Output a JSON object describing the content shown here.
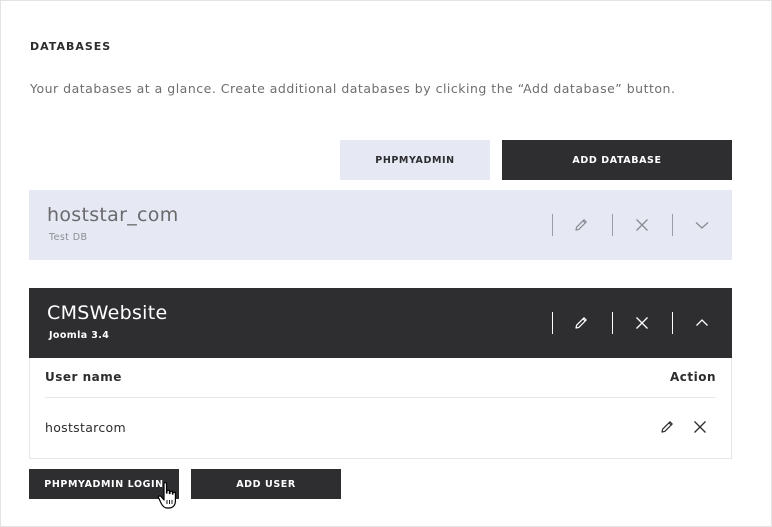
{
  "section": {
    "title": "DATABASES",
    "description": "Your databases at a glance. Create additional databases by clicking the “Add database” button."
  },
  "toolbar": {
    "phpmyadmin_label": "PHPMYADMIN",
    "add_database_label": "ADD DATABASE"
  },
  "databases": [
    {
      "name": "hoststar_com",
      "description": "Test DB",
      "expanded": false
    },
    {
      "name": "CMSWebsite",
      "description": "Joomla 3.4",
      "expanded": true
    }
  ],
  "users_table": {
    "columns": [
      "User name",
      "Action"
    ],
    "rows": [
      {
        "username": "hoststarcom"
      }
    ]
  },
  "footer_actions": {
    "phpmyadmin_login_label": "PHPMYADMIN LOGIN",
    "add_user_label": "ADD USER"
  },
  "icons": {
    "edit": "pencil-icon",
    "delete": "close-icon",
    "expand": "chevron-down-icon",
    "collapse": "chevron-up-icon",
    "cursor": "hand-pointer-icon"
  },
  "colors": {
    "dark": "#2e2e31",
    "light": "#e6e9f4",
    "muted_text": "#6e6e6e"
  }
}
